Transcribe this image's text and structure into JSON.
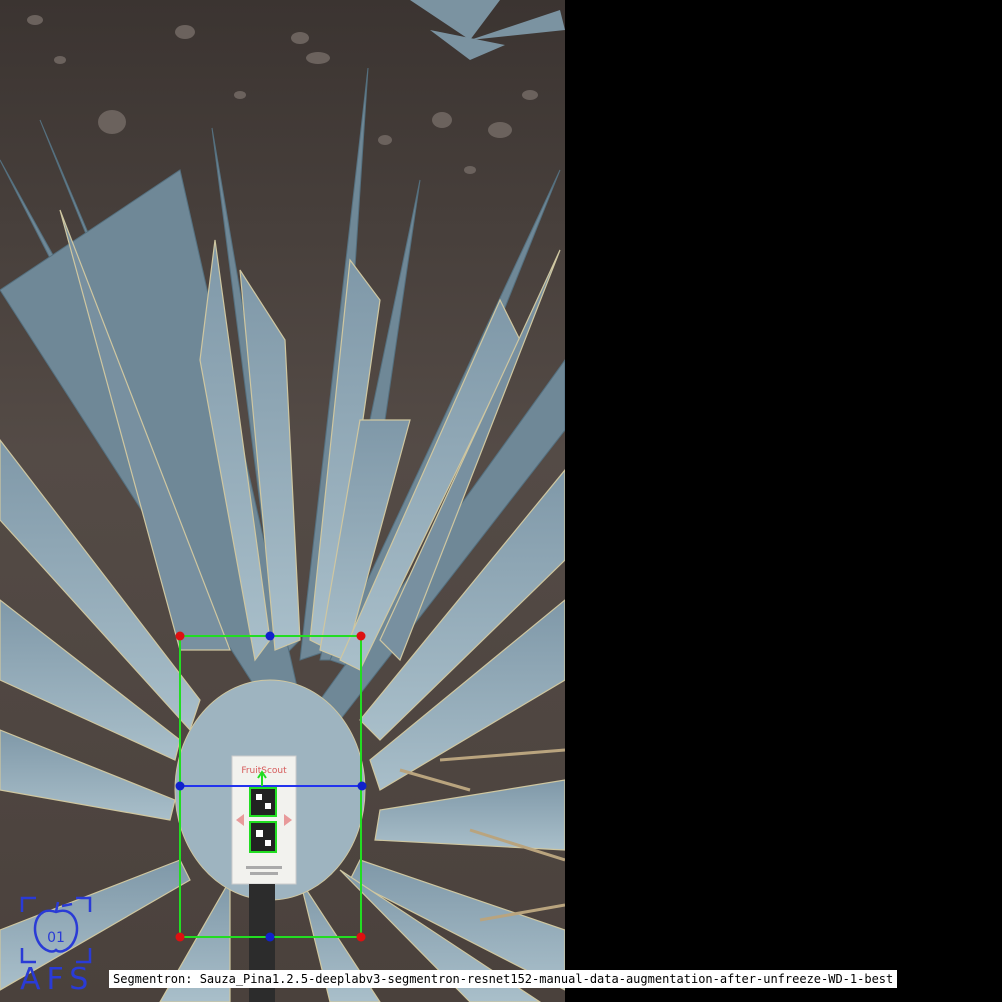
{
  "image": {
    "caption": "Segmentron: Sauza_Pina1.2.5-deeplabv3-segmentron-resnet152-manual-data-augmentation-after-unfreeze-WD-1-best",
    "logo_text": "AFS",
    "marker_card_title": "FruitScout"
  },
  "colors": {
    "soil": "#4e4641",
    "leaf": "#8fa8b6",
    "leaf_dark": "#5d7686",
    "leaf_edge": "#d9cfa6",
    "segmentation_outline": "#22dd22",
    "measure_line": "#2233ee",
    "corner_point": "#dd1111",
    "mid_point": "#1122cc",
    "logo": "#2a3bd6"
  }
}
